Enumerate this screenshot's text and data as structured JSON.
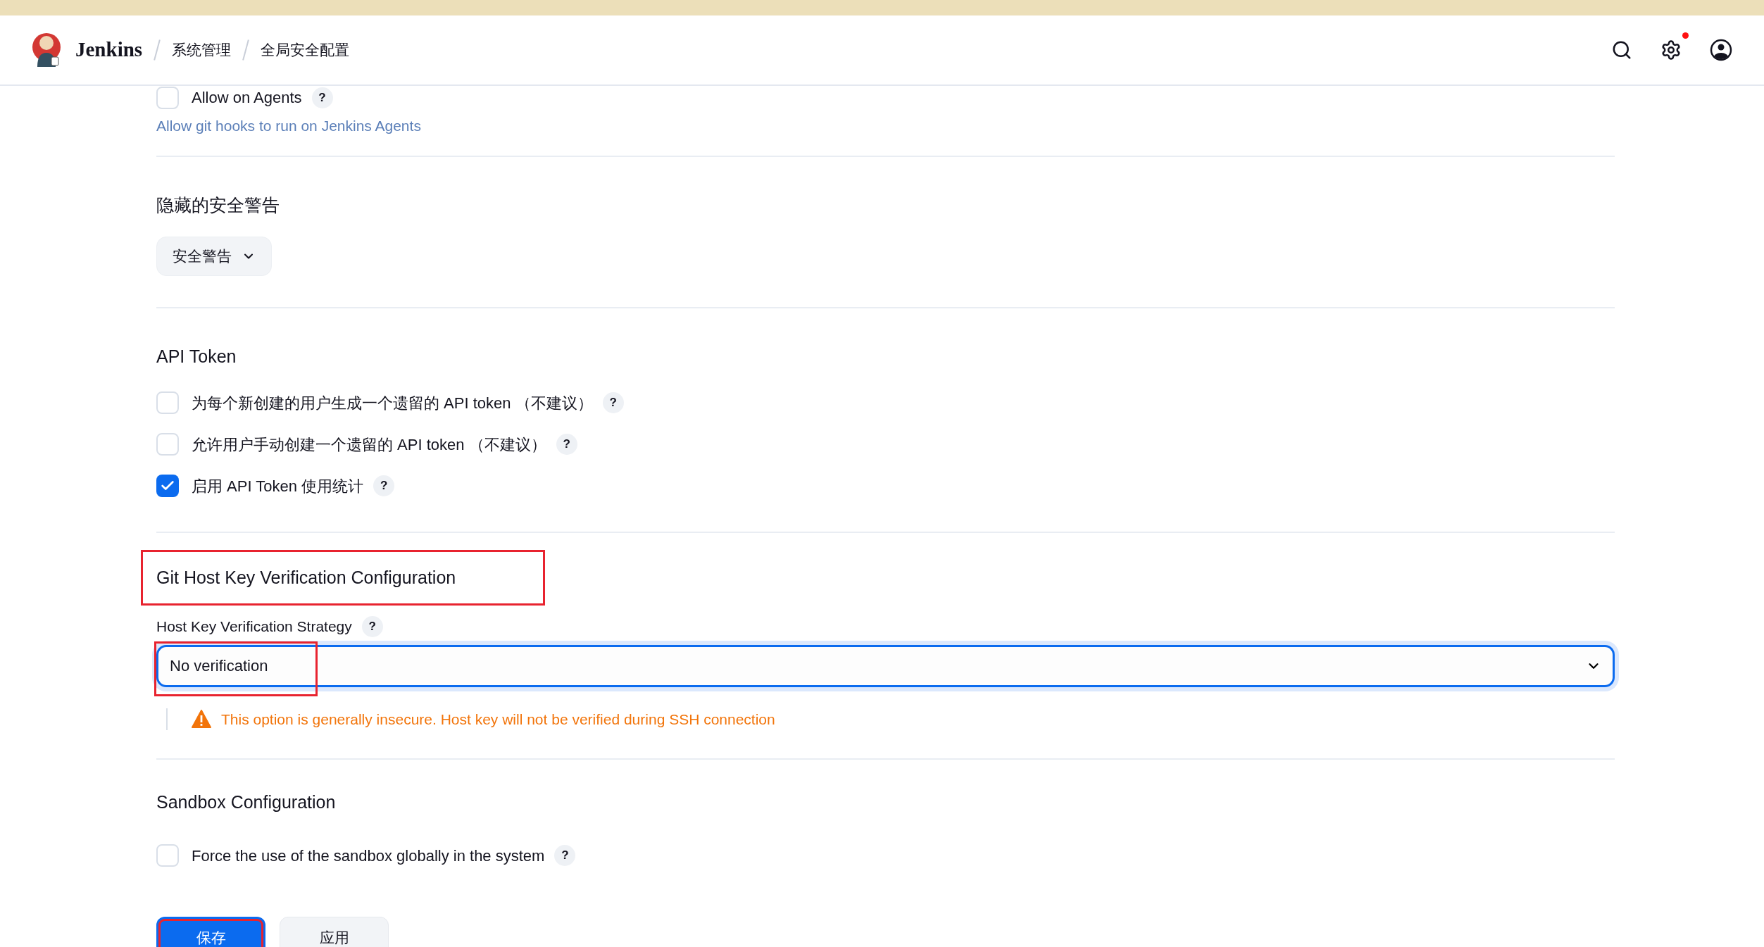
{
  "header": {
    "logo_text": "Jenkins",
    "breadcrumbs": [
      "系统管理",
      "全局安全配置"
    ],
    "settings_notification": true
  },
  "git_hooks": [
    {
      "label": "Allow on Agents",
      "help": "?",
      "checked": false,
      "description": "Allow git hooks to run on Jenkins Agents"
    }
  ],
  "hidden_warnings": {
    "title": "隐藏的安全警告",
    "button": "安全警告"
  },
  "api_token": {
    "title": "API Token",
    "options": [
      {
        "label": "为每个新创建的用户生成一个遗留的 API token （不建议）",
        "help": "?",
        "checked": false
      },
      {
        "label": "允许用户手动创建一个遗留的 API token （不建议）",
        "help": "?",
        "checked": false
      },
      {
        "label": "启用 API Token 使用统计",
        "help": "?",
        "checked": true
      }
    ]
  },
  "git_host_key": {
    "title": "Git Host Key Verification Configuration",
    "annotated": true,
    "field_label": "Host Key Verification Strategy",
    "help": "?",
    "strategy": {
      "value": "No verification",
      "annotated": true
    },
    "warning": "This option is generally insecure. Host key will not be verified during SSH connection"
  },
  "sandbox": {
    "title": "Sandbox Configuration",
    "options": [
      {
        "label": "Force the use of the sandbox globally in the system",
        "help": "?",
        "checked": false
      }
    ]
  },
  "buttons": [
    {
      "label": "保存",
      "kind": "primary",
      "annotated": true
    },
    {
      "label": "应用",
      "kind": "secondary",
      "annotated": false
    }
  ]
}
